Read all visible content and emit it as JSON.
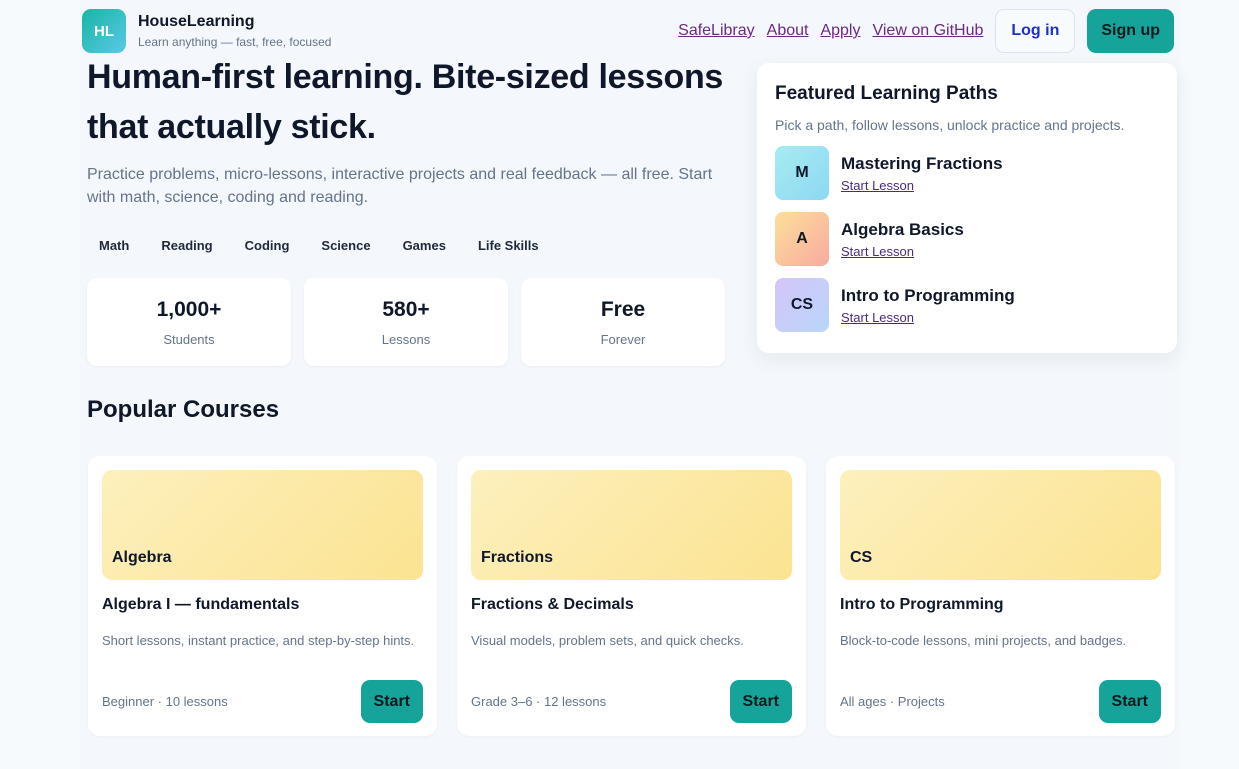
{
  "brand": {
    "logo_text": "HL",
    "name": "HouseLearning",
    "tagline": "Learn anything — fast, free, focused"
  },
  "nav": {
    "links": [
      "SafeLibray",
      "About",
      "Apply",
      "View on GitHub"
    ],
    "login_label": "Log in",
    "signup_label": "Sign up"
  },
  "hero": {
    "title": "Human-first learning. Bite-sized lessons that actually stick.",
    "subtitle": "Practice problems, micro-lessons, interactive projects and real feedback — all free. Start with math, science, coding and reading.",
    "subjects": [
      "Math",
      "Reading",
      "Coding",
      "Science",
      "Games",
      "Life Skills"
    ],
    "stats": [
      {
        "value": "1,000+",
        "label": "Students"
      },
      {
        "value": "580+",
        "label": "Lessons"
      },
      {
        "value": "Free",
        "label": "Forever"
      }
    ]
  },
  "featured": {
    "title": "Featured Learning Paths",
    "subtitle": "Pick a path, follow lessons, unlock practice and projects.",
    "paths": [
      {
        "badge": "M",
        "name": "Mastering Fractions",
        "link": "Start Lesson"
      },
      {
        "badge": "A",
        "name": "Algebra Basics",
        "link": "Start Lesson"
      },
      {
        "badge": "CS",
        "name": "Intro to Programming",
        "link": "Start Lesson"
      }
    ]
  },
  "popular": {
    "title": "Popular Courses",
    "courses": [
      {
        "thumb": "Algebra",
        "title": "Algebra I — fundamentals",
        "desc": "Short lessons, instant practice, and step-by-step hints.",
        "meta": "Beginner · 10 lessons",
        "button": "Start"
      },
      {
        "thumb": "Fractions",
        "title": "Fractions & Decimals",
        "desc": "Visual models, problem sets, and quick checks.",
        "meta": "Grade 3–6 · 12 lessons",
        "button": "Start"
      },
      {
        "thumb": "CS",
        "title": "Intro to Programming",
        "desc": "Block-to-code lessons, mini projects, and badges.",
        "meta": "All ages · Projects",
        "button": "Start"
      }
    ]
  },
  "colors": {
    "accent": "#16a39a",
    "link": "#6b2a83",
    "login_text": "#1d2fcc"
  }
}
